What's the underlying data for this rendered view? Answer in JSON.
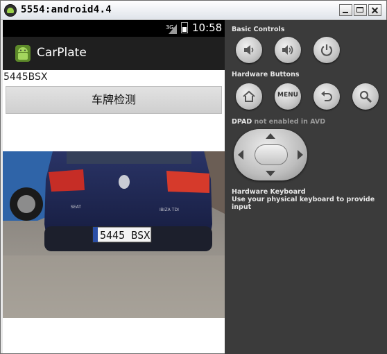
{
  "window": {
    "title": "5554:android4.4"
  },
  "device": {
    "status": {
      "network": "3G",
      "time": "10:58"
    },
    "action_bar": {
      "title": "CarPlate"
    },
    "result_text": "5445BSX",
    "detect_button_label": "车牌检测",
    "photo": {
      "plate_text": "5445 BSX",
      "badge_text": "IBIZA TDI",
      "brand_text": "SEAT"
    }
  },
  "controls": {
    "basic_controls_label": "Basic Controls",
    "hardware_buttons_label": "Hardware Buttons",
    "menu_label": "MENU",
    "dpad_label": "DPAD",
    "dpad_note": "not enabled in AVD",
    "keyboard_label": "Hardware Keyboard",
    "keyboard_note": "Use your physical keyboard to provide input"
  }
}
